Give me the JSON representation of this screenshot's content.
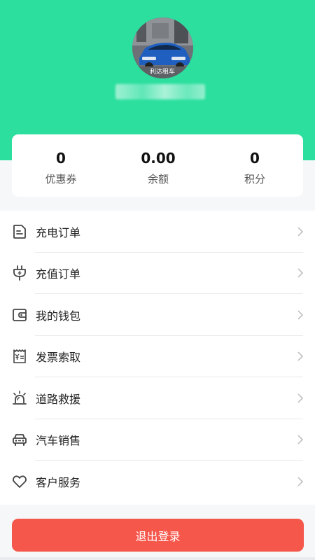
{
  "profile": {
    "avatar_caption": "利达租车",
    "avatar_icon": "car-photo"
  },
  "stats": [
    {
      "value": "0",
      "label": "优惠券"
    },
    {
      "value": "0.00",
      "label": "余额"
    },
    {
      "value": "0",
      "label": "积分"
    }
  ],
  "menu": [
    {
      "label": "充电订单",
      "icon": "document-icon"
    },
    {
      "label": "充值订单",
      "icon": "plug-icon"
    },
    {
      "label": "我的钱包",
      "icon": "wallet-icon"
    },
    {
      "label": "发票索取",
      "icon": "invoice-icon"
    },
    {
      "label": "道路救援",
      "icon": "alarm-light-icon"
    },
    {
      "label": "汽车销售",
      "icon": "car-icon"
    },
    {
      "label": "客户服务",
      "icon": "heart-icon"
    }
  ],
  "logout_label": "退出登录",
  "colors": {
    "header_green": "#2cdf9f",
    "logout_red": "#f6574b",
    "background": "#f5f7f9"
  }
}
